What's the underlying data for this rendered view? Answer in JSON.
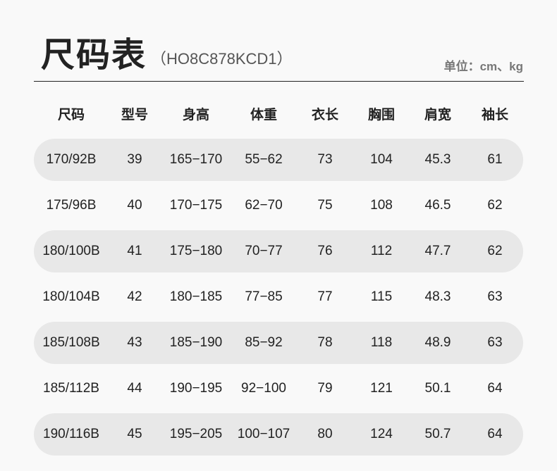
{
  "title": "尺码表",
  "model_code": "（HO8C878KCD1）",
  "unit_label": "单位：cm、kg",
  "headers": [
    "尺码",
    "型号",
    "身高",
    "体重",
    "衣长",
    "胸围",
    "肩宽",
    "袖长"
  ],
  "rows": [
    [
      "170/92B",
      "39",
      "165−170",
      "55−62",
      "73",
      "104",
      "45.3",
      "61"
    ],
    [
      "175/96B",
      "40",
      "170−175",
      "62−70",
      "75",
      "108",
      "46.5",
      "62"
    ],
    [
      "180/100B",
      "41",
      "175−180",
      "70−77",
      "76",
      "112",
      "47.7",
      "62"
    ],
    [
      "180/104B",
      "42",
      "180−185",
      "77−85",
      "77",
      "115",
      "48.3",
      "63"
    ],
    [
      "185/108B",
      "43",
      "185−190",
      "85−92",
      "78",
      "118",
      "48.9",
      "63"
    ],
    [
      "185/112B",
      "44",
      "190−195",
      "92−100",
      "79",
      "121",
      "50.1",
      "64"
    ],
    [
      "190/116B",
      "45",
      "195−205",
      "100−107",
      "80",
      "124",
      "50.7",
      "64"
    ]
  ]
}
